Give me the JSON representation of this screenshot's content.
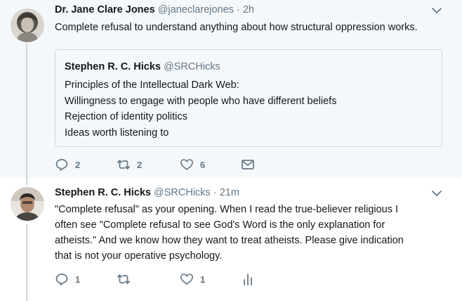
{
  "tweets": [
    {
      "author_name": "Dr. Jane Clare Jones",
      "handle": "@janeclarejones",
      "separator": "·",
      "time": "2h",
      "text": "Complete refusal to understand anything about how structural oppression works.",
      "quote": {
        "author_name": "Stephen R. C. Hicks",
        "handle": "@SRCHicks",
        "lines": [
          "Principles of the Intellectual Dark Web:",
          "Willingness to engage with people who have different beliefs",
          "Rejection of identity politics",
          "Ideas worth listening to"
        ]
      },
      "actions": {
        "replies": "2",
        "retweets": "2",
        "likes": "6"
      }
    },
    {
      "author_name": "Stephen R. C. Hicks",
      "handle": "@SRCHicks",
      "separator": "·",
      "time": "21m",
      "text_lines": [
        "\"Complete refusal\" as your opening. When I read the true-believer religious I",
        "often see \"Complete refusal to see God's Word is the only explanation for",
        "atheists.\" And we know how they want to treat atheists. Please give indication",
        "that is not your operative psychology."
      ],
      "actions": {
        "replies": "1",
        "likes": "1"
      }
    }
  ],
  "icons": {
    "reply": "reply-icon",
    "retweet": "retweet-icon",
    "like": "heart-icon",
    "dm": "envelope-icon",
    "analytics": "analytics-icon",
    "more": "chevron-down-icon"
  },
  "colors": {
    "background_focused": "#f5f8fa",
    "secondary_text": "#657786",
    "border": "#ccd6dd"
  }
}
